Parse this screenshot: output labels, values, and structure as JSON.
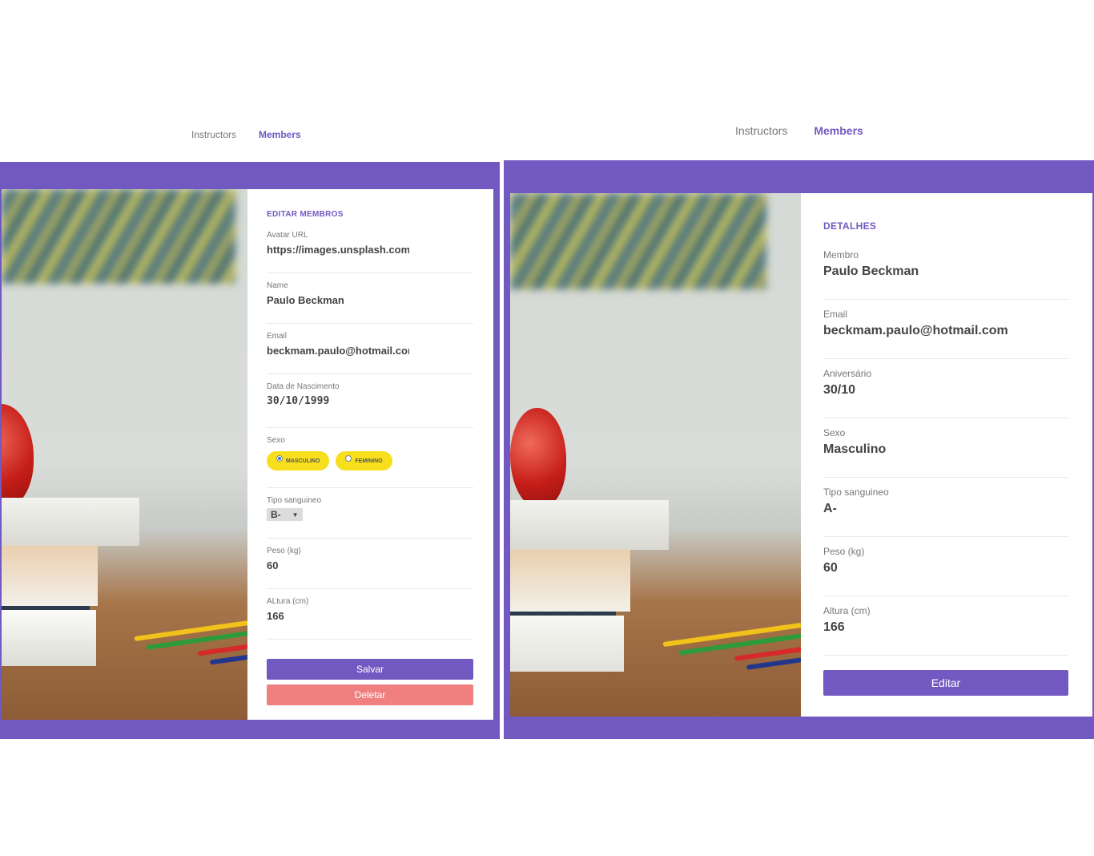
{
  "left": {
    "nav": {
      "instructors": "Instructors",
      "members": "Members"
    },
    "form": {
      "title": "EDITAR MEMBROS",
      "avatar_label": "Avatar URL",
      "avatar_value": "https://images.unsplash.com/photo",
      "name_label": "Name",
      "name_value": "Paulo Beckman",
      "email_label": "Email",
      "email_value": "beckmam.paulo@hotmail.com",
      "birth_label": "Data de Nascimento",
      "birth_value": "30/10/1999",
      "gender_label": "Sexo",
      "gender_options": [
        "MASCULINO",
        "FEMININO"
      ],
      "gender_selected": "MASCULINO",
      "blood_label": "Tipo sanguineo",
      "blood_value": "B-",
      "weight_label": "Peso (kg)",
      "weight_value": "60",
      "height_label": "ALtura (cm)",
      "height_value": "166",
      "save_label": "Salvar",
      "delete_label": "Deletar"
    }
  },
  "right": {
    "nav": {
      "instructors": "Instructors",
      "members": "Members"
    },
    "details": {
      "title": "DETALHES",
      "member_label": "Membro",
      "member_value": "Paulo Beckman",
      "email_label": "Email",
      "email_value": "beckmam.paulo@hotmail.com",
      "birthday_label": "Aniversário",
      "birthday_value": "30/10",
      "gender_label": "Sexo",
      "gender_value": "Masculino",
      "blood_label": "Tipo sanguineo",
      "blood_value": "A-",
      "weight_label": "Peso (kg)",
      "weight_value": "60",
      "height_label": "Altura (cm)",
      "height_value": "166",
      "edit_label": "Editar"
    }
  },
  "colors": {
    "accent": "#7159c1",
    "radio_pill": "#f7df1e",
    "delete": "#f08080"
  }
}
